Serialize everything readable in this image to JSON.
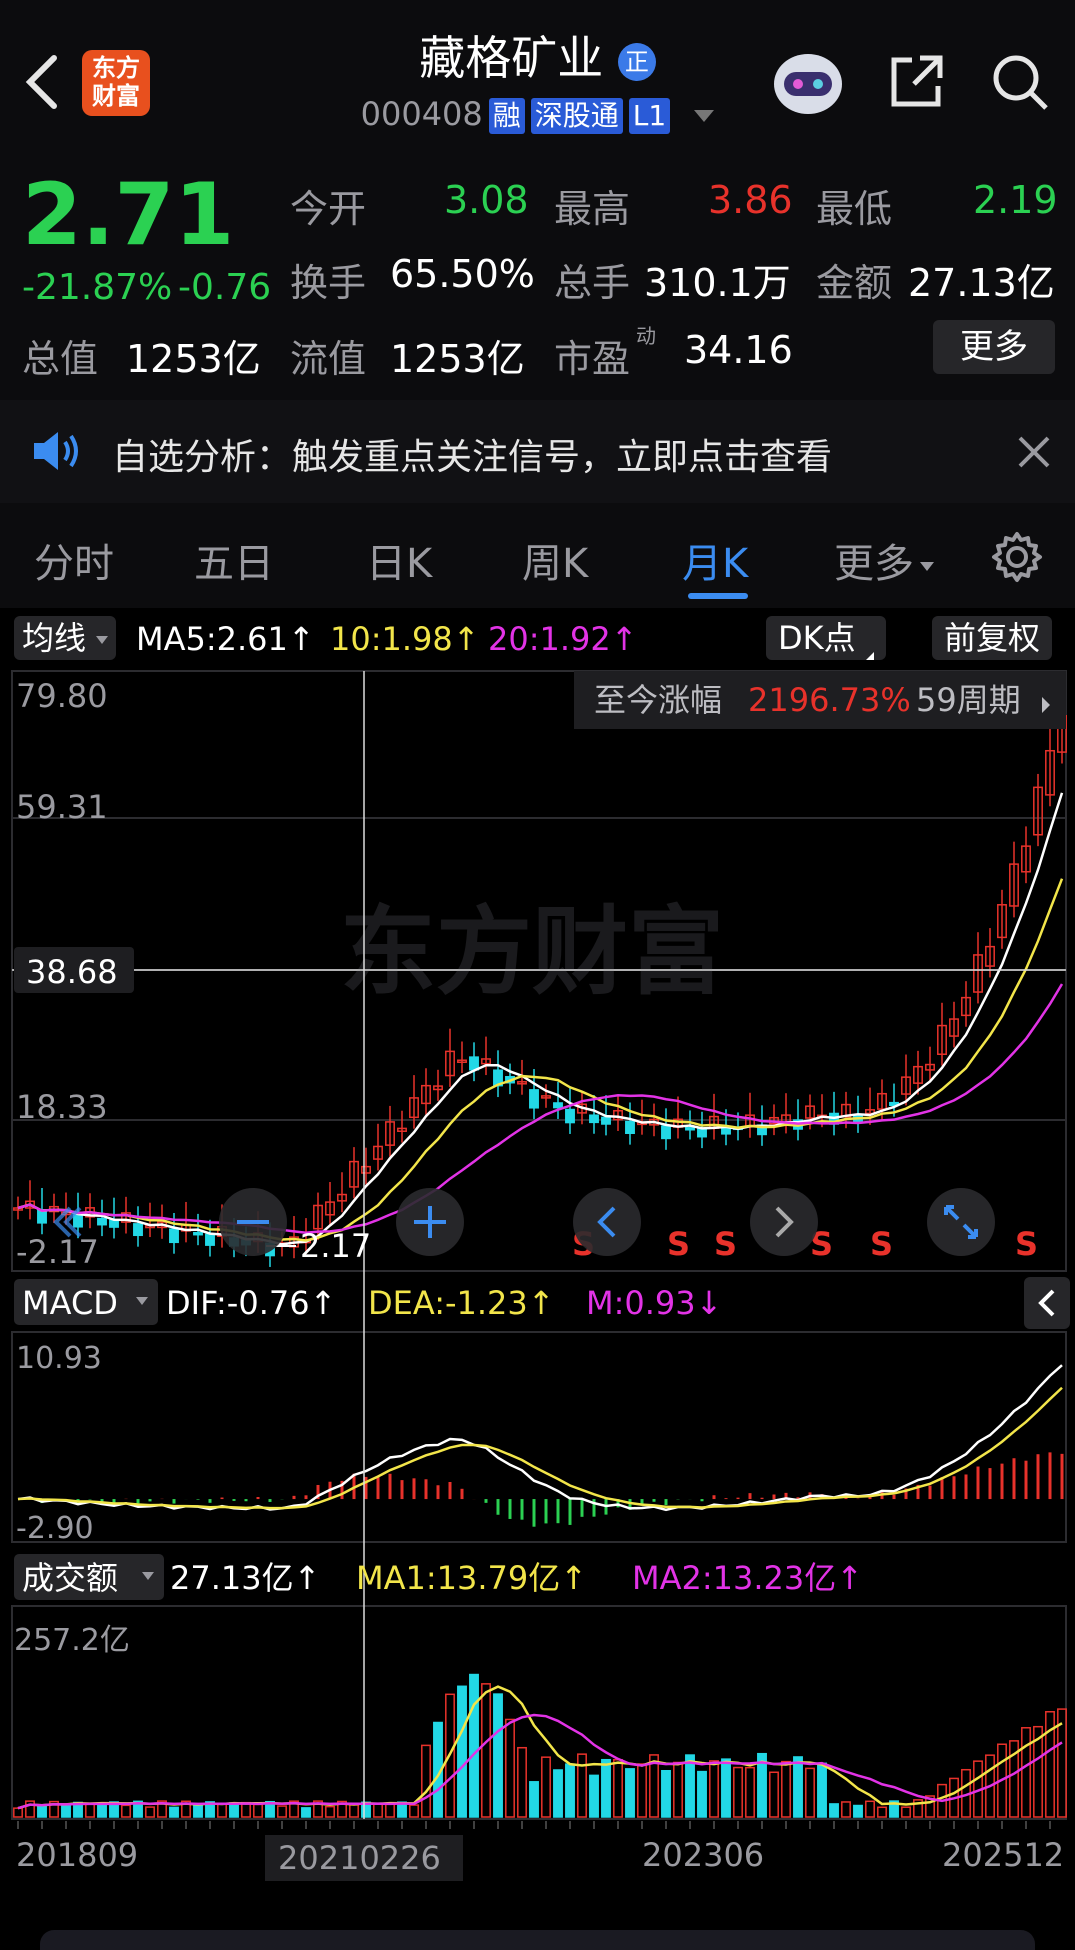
{
  "header": {
    "app_logo": "东方\n财富",
    "title": "藏格矿业",
    "title_badge": "正",
    "code": "000408",
    "tags": [
      "融",
      "深股通",
      "L1"
    ]
  },
  "quote": {
    "price": "2.71",
    "change_pct": "-21.87%",
    "change": "-0.76",
    "open_label": "今开",
    "open": "3.08",
    "high_label": "最高",
    "high": "3.86",
    "low_label": "最低",
    "low": "2.19",
    "turnover_label": "换手",
    "turnover": "65.50%",
    "volume_label": "总手",
    "volume": "310.1万",
    "amount_label": "金额",
    "amount": "27.13亿",
    "total_cap_label": "总值",
    "total_cap": "1253亿",
    "float_cap_label": "流值",
    "float_cap": "1253亿",
    "pe_label": "市盈",
    "pe_sup": "动",
    "pe": "34.16",
    "more_label": "更多"
  },
  "notice": {
    "text": "自选分析：触发重点关注信号，立即点击查看"
  },
  "tabs": [
    "分时",
    "五日",
    "日K",
    "周K",
    "月K",
    "更多"
  ],
  "active_tab": "月K",
  "kline": {
    "ma_selector": "均线",
    "ma5": "MA5:2.61↑",
    "ma10": "10:1.98↑",
    "ma20": "20:1.92↑",
    "dk_button": "DK点",
    "adjust_button": "前复权",
    "gain_label": "至今涨幅",
    "gain_value": "2196.73%",
    "period_label": "59周期",
    "y_ticks": [
      "79.80",
      "59.31",
      "18.33",
      "-2.17"
    ],
    "crosshair_price": "38.68",
    "low_marker": "2.17",
    "sell_marker": "S",
    "watermark": "东方财富"
  },
  "macd": {
    "selector": "MACD",
    "dif": "DIF:-0.76↑",
    "dea": "DEA:-1.23↑",
    "m": "M:0.93↓",
    "y_top": "10.93",
    "y_bottom": "-2.90"
  },
  "amount_panel": {
    "selector": "成交额",
    "value": "27.13亿↑",
    "ma1": "MA1:13.79亿↑",
    "ma2": "MA2:13.23亿↑",
    "y_top": "257.2亿"
  },
  "x_axis": {
    "start": "201809",
    "crosshair": "20210226",
    "mid": "202306",
    "end": "202512"
  },
  "colors": {
    "up": "#e8322b",
    "down": "#22d8e6",
    "ma5": "#ffffff",
    "ma10": "#f2e54a",
    "ma20": "#e233e6"
  }
}
